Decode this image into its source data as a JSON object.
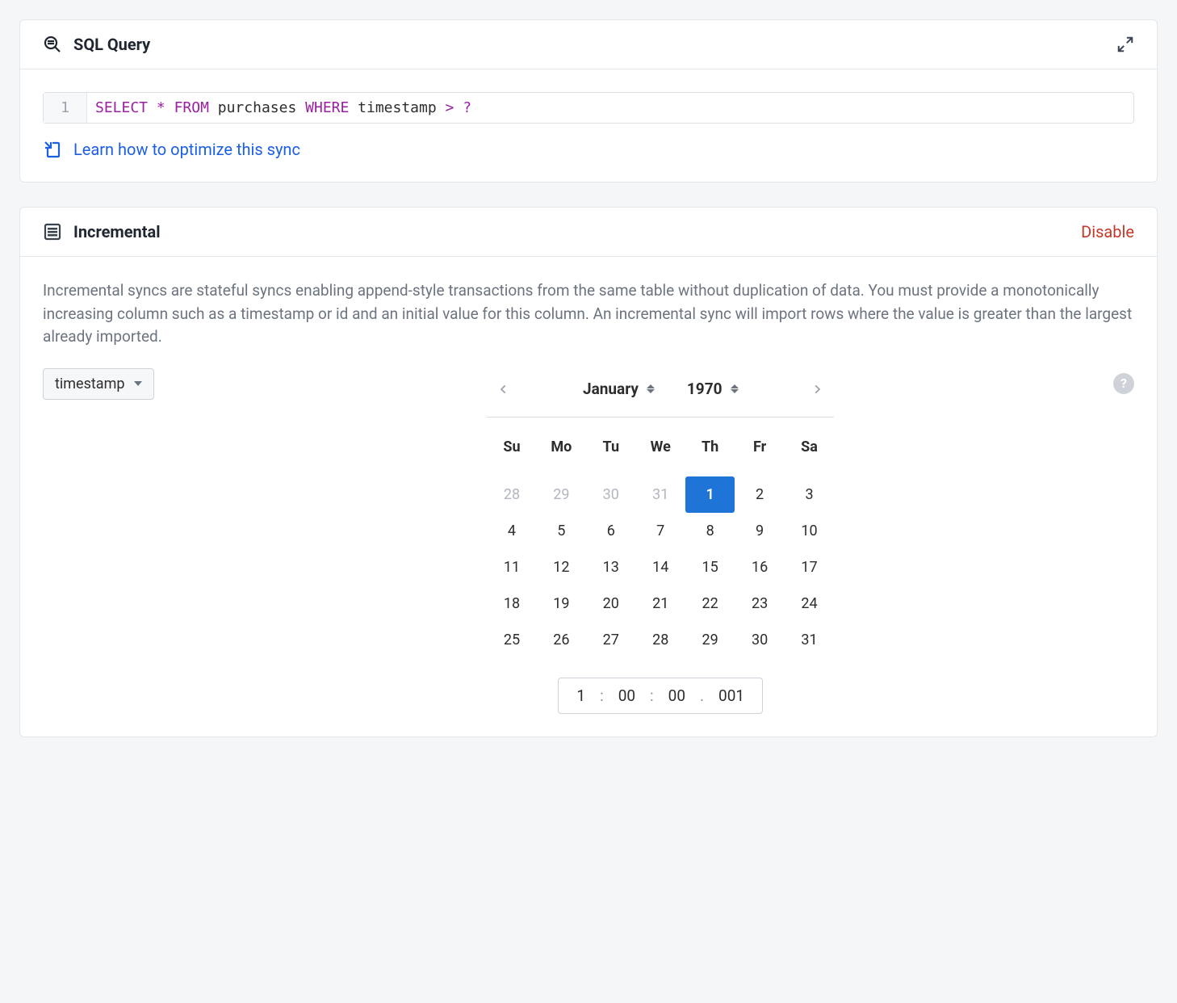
{
  "sql_panel": {
    "title": "SQL Query",
    "line_number": "1",
    "tokens": [
      {
        "t": "SELECT",
        "c": "kw"
      },
      {
        "t": " ",
        "c": "plain"
      },
      {
        "t": "*",
        "c": "sym"
      },
      {
        "t": " ",
        "c": "plain"
      },
      {
        "t": "FROM",
        "c": "kw"
      },
      {
        "t": " purchases ",
        "c": "plain"
      },
      {
        "t": "WHERE",
        "c": "kw"
      },
      {
        "t": " timestamp ",
        "c": "plain"
      },
      {
        "t": ">",
        "c": "sym"
      },
      {
        "t": " ",
        "c": "plain"
      },
      {
        "t": "?",
        "c": "sym"
      }
    ],
    "optimize_link": "Learn how to optimize this sync"
  },
  "incremental_panel": {
    "title": "Incremental",
    "disable_label": "Disable",
    "description": "Incremental syncs are stateful syncs enabling append-style transactions from the same table without duplication of data. You must provide a monotonically increasing column such as a timestamp or id and an initial value for this column. An incremental sync will import rows where the value is greater than the largest already imported.",
    "column_select": "timestamp"
  },
  "datepicker": {
    "month": "January",
    "year": "1970",
    "dow": [
      "Su",
      "Mo",
      "Tu",
      "We",
      "Th",
      "Fr",
      "Sa"
    ],
    "weeks": [
      [
        {
          "d": "28",
          "o": true
        },
        {
          "d": "29",
          "o": true
        },
        {
          "d": "30",
          "o": true
        },
        {
          "d": "31",
          "o": true
        },
        {
          "d": "1",
          "sel": true
        },
        {
          "d": "2"
        },
        {
          "d": "3"
        }
      ],
      [
        {
          "d": "4"
        },
        {
          "d": "5"
        },
        {
          "d": "6"
        },
        {
          "d": "7"
        },
        {
          "d": "8"
        },
        {
          "d": "9"
        },
        {
          "d": "10"
        }
      ],
      [
        {
          "d": "11"
        },
        {
          "d": "12"
        },
        {
          "d": "13"
        },
        {
          "d": "14"
        },
        {
          "d": "15"
        },
        {
          "d": "16"
        },
        {
          "d": "17"
        }
      ],
      [
        {
          "d": "18"
        },
        {
          "d": "19"
        },
        {
          "d": "20"
        },
        {
          "d": "21"
        },
        {
          "d": "22"
        },
        {
          "d": "23"
        },
        {
          "d": "24"
        }
      ],
      [
        {
          "d": "25"
        },
        {
          "d": "26"
        },
        {
          "d": "27"
        },
        {
          "d": "28"
        },
        {
          "d": "29"
        },
        {
          "d": "30"
        },
        {
          "d": "31"
        }
      ]
    ],
    "time": {
      "h": "1",
      "m": "00",
      "s": "00",
      "ms": "001"
    },
    "colon": ":",
    "dot": "."
  }
}
